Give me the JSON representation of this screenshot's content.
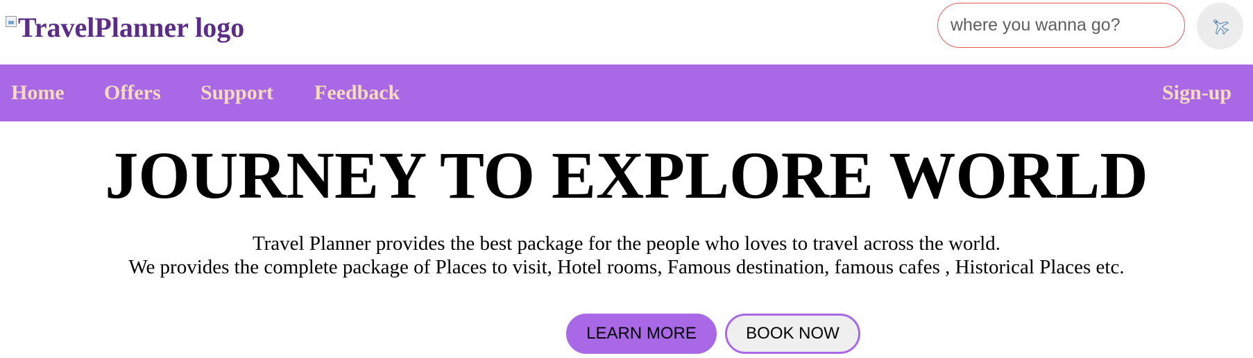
{
  "header": {
    "logo_alt": "TravelPlanner logo",
    "search": {
      "placeholder": "where you wanna go?",
      "value": ""
    },
    "go_button_icon": "airplane-icon"
  },
  "nav": {
    "items": [
      {
        "label": "Home"
      },
      {
        "label": "Offers"
      },
      {
        "label": "Support"
      },
      {
        "label": "Feedback"
      }
    ],
    "signup_label": "Sign-up"
  },
  "hero": {
    "title": "JOURNEY TO EXPLORE WORLD",
    "line1": "Travel Planner provides the best package for the people who loves to travel across the world.",
    "line2": "We provides the complete package of Places to visit, Hotel rooms, Famous destination, famous cafes , Historical Places etc.",
    "learn_more_label": "LEARN MORE",
    "book_now_label": "BOOK NOW"
  },
  "colors": {
    "accent": "#a968e6",
    "nav_text": "#f6dcbc",
    "logo_text": "#5b2d86",
    "search_border": "#e35a5a"
  }
}
